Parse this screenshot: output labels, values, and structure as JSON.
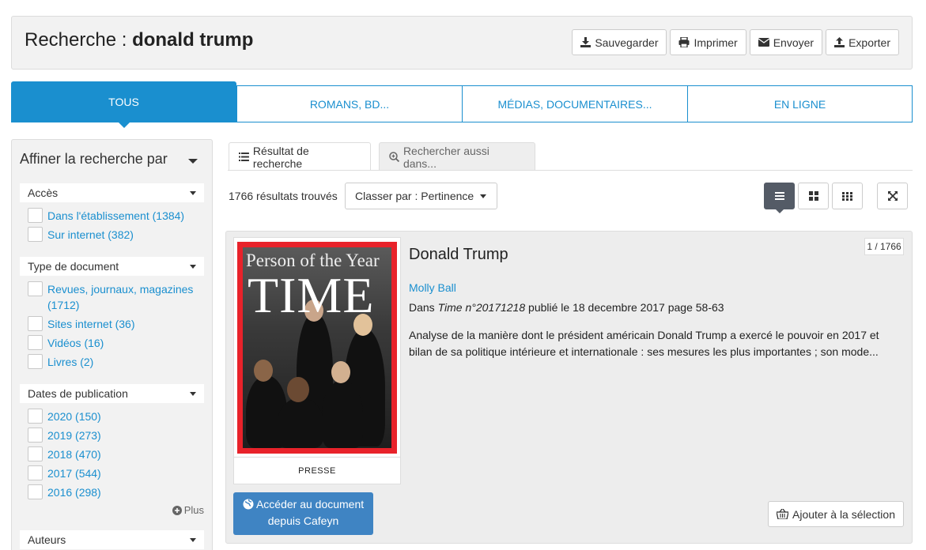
{
  "header": {
    "search_label": "Recherche : ",
    "query": "donald trump",
    "actions": {
      "save": "Sauvegarder",
      "print": "Imprimer",
      "send": "Envoyer",
      "export": "Exporter"
    }
  },
  "tabs": [
    "TOUS",
    "ROMANS, BD...",
    "MÉDIAS, DOCUMENTAIRES...",
    "EN LIGNE"
  ],
  "sidebar": {
    "title": "Affiner la recherche par",
    "facets": {
      "access": {
        "label": "Accès",
        "items": [
          "Dans l'établissement (1384)",
          "Sur internet (382)"
        ]
      },
      "doctype": {
        "label": "Type de document",
        "items": [
          "Revues, journaux, magazines (1712)",
          "Sites internet (36)",
          "Vidéos (16)",
          "Livres (2)"
        ]
      },
      "dates": {
        "label": "Dates de publication",
        "items": [
          "2020 (150)",
          "2019 (273)",
          "2018 (470)",
          "2017 (544)",
          "2016 (298)"
        ],
        "more": "Plus"
      },
      "authors": {
        "label": "Auteurs"
      }
    }
  },
  "results": {
    "tabs": {
      "results": "Résultat de recherche",
      "also": "Rechercher aussi dans..."
    },
    "count": "1766 résultats trouvés",
    "sort": "Classer par : Pertinence",
    "item": {
      "title": "Donald Trump",
      "counter": "1 / 1766",
      "author": "Molly Ball",
      "source_prefix": "Dans ",
      "source_title": "Time n°20171218",
      "source_suffix": " publié le 18 decembre 2017 page 58-63",
      "abstract": "Analyse de la manière dont le président américain Donald Trump a exercé le pouvoir en 2017 et bilan de sa politique intérieure et internationale : ses mesures les plus importantes ; son mode...",
      "doc_type": "PRESSE",
      "cover": {
        "line1": "Person of the Year",
        "line2": "TIME"
      },
      "access_button": "Accéder au document depuis Cafeyn",
      "add_button": "Ajouter à la sélection"
    }
  },
  "colors": {
    "accent": "#1a8fcf",
    "button_blue": "#3f84c3",
    "view_active": "#545b66",
    "time_red": "#e8222a"
  }
}
